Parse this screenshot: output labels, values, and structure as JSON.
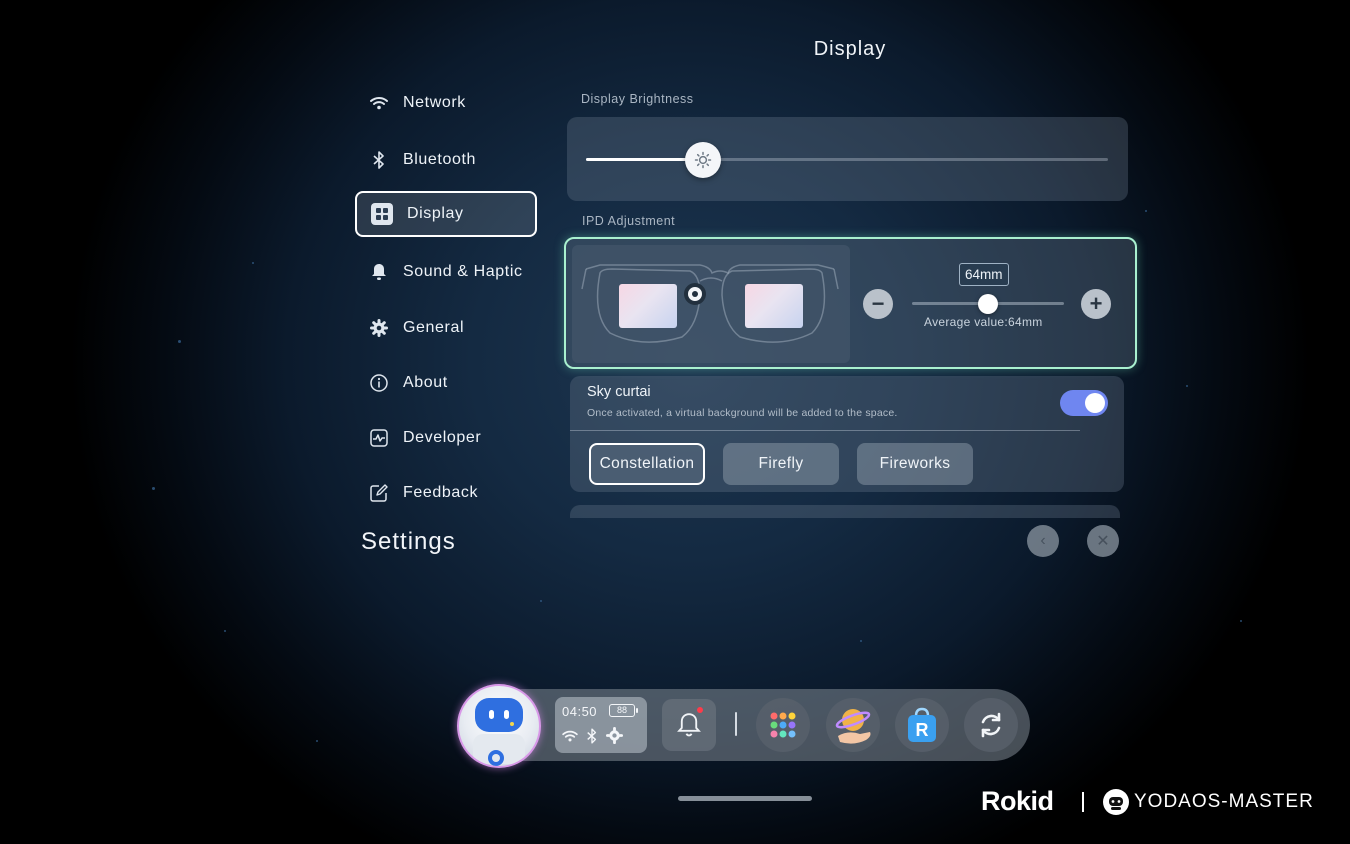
{
  "page": {
    "title": "Display"
  },
  "sidebar": {
    "items": [
      {
        "label": "Network",
        "icon": "wifi-icon"
      },
      {
        "label": "Bluetooth",
        "icon": "bluetooth-icon"
      },
      {
        "label": "Display",
        "icon": "display-icon",
        "active": true
      },
      {
        "label": "Sound & Haptic",
        "icon": "bell-icon"
      },
      {
        "label": "General",
        "icon": "gear-icon"
      },
      {
        "label": "About",
        "icon": "info-icon"
      },
      {
        "label": "Developer",
        "icon": "pulse-icon"
      },
      {
        "label": "Feedback",
        "icon": "edit-icon"
      }
    ],
    "footer_title": "Settings"
  },
  "brightness": {
    "label": "Display Brightness",
    "value_fraction": 0.225
  },
  "ipd": {
    "label": "IPD Adjustment",
    "value": "64mm",
    "average_text": "Average value:64mm",
    "slider_fraction": 0.5,
    "decrease_symbol": "−",
    "increase_symbol": "+"
  },
  "sky_curtain": {
    "title": "Sky curtai",
    "description": "Once activated, a virtual background will be added to the space.",
    "enabled": true,
    "options": [
      {
        "label": "Constellation",
        "selected": true
      },
      {
        "label": "Firefly",
        "selected": false
      },
      {
        "label": "Fireworks",
        "selected": false
      }
    ]
  },
  "controls": {
    "back_symbol": "‹",
    "close_symbol": "✕"
  },
  "dock": {
    "time": "04:50",
    "battery": "88",
    "accent_color": "#d898e8",
    "notification_color": "#ff3b4a"
  },
  "branding": {
    "left": "Rokid",
    "right": "YODAOS-MASTER"
  }
}
